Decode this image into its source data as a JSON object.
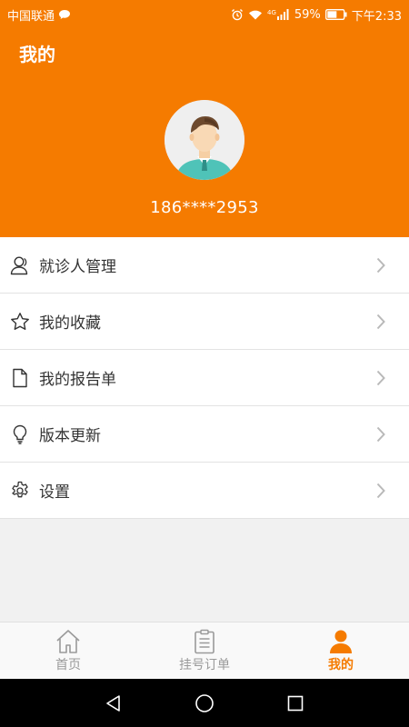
{
  "status_bar": {
    "carrier": "中国联通",
    "network": "4G",
    "battery": "59%",
    "time": "下午2:33"
  },
  "header": {
    "title": "我的",
    "phone": "186****2953"
  },
  "menu": {
    "items": [
      {
        "label": "就诊人管理",
        "icon": "person-icon"
      },
      {
        "label": "我的收藏",
        "icon": "star-icon"
      },
      {
        "label": "我的报告单",
        "icon": "document-icon"
      },
      {
        "label": "版本更新",
        "icon": "lightbulb-icon"
      },
      {
        "label": "设置",
        "icon": "gear-icon"
      }
    ]
  },
  "tabs": {
    "items": [
      {
        "label": "首页",
        "icon": "home-icon",
        "active": false
      },
      {
        "label": "挂号订单",
        "icon": "clipboard-icon",
        "active": false
      },
      {
        "label": "我的",
        "icon": "person-icon",
        "active": true
      }
    ]
  },
  "colors": {
    "accent": "#f57b00",
    "background": "#f1f1f1",
    "divider": "#e3e3e3",
    "inactive_tab": "#9a9a9a"
  }
}
